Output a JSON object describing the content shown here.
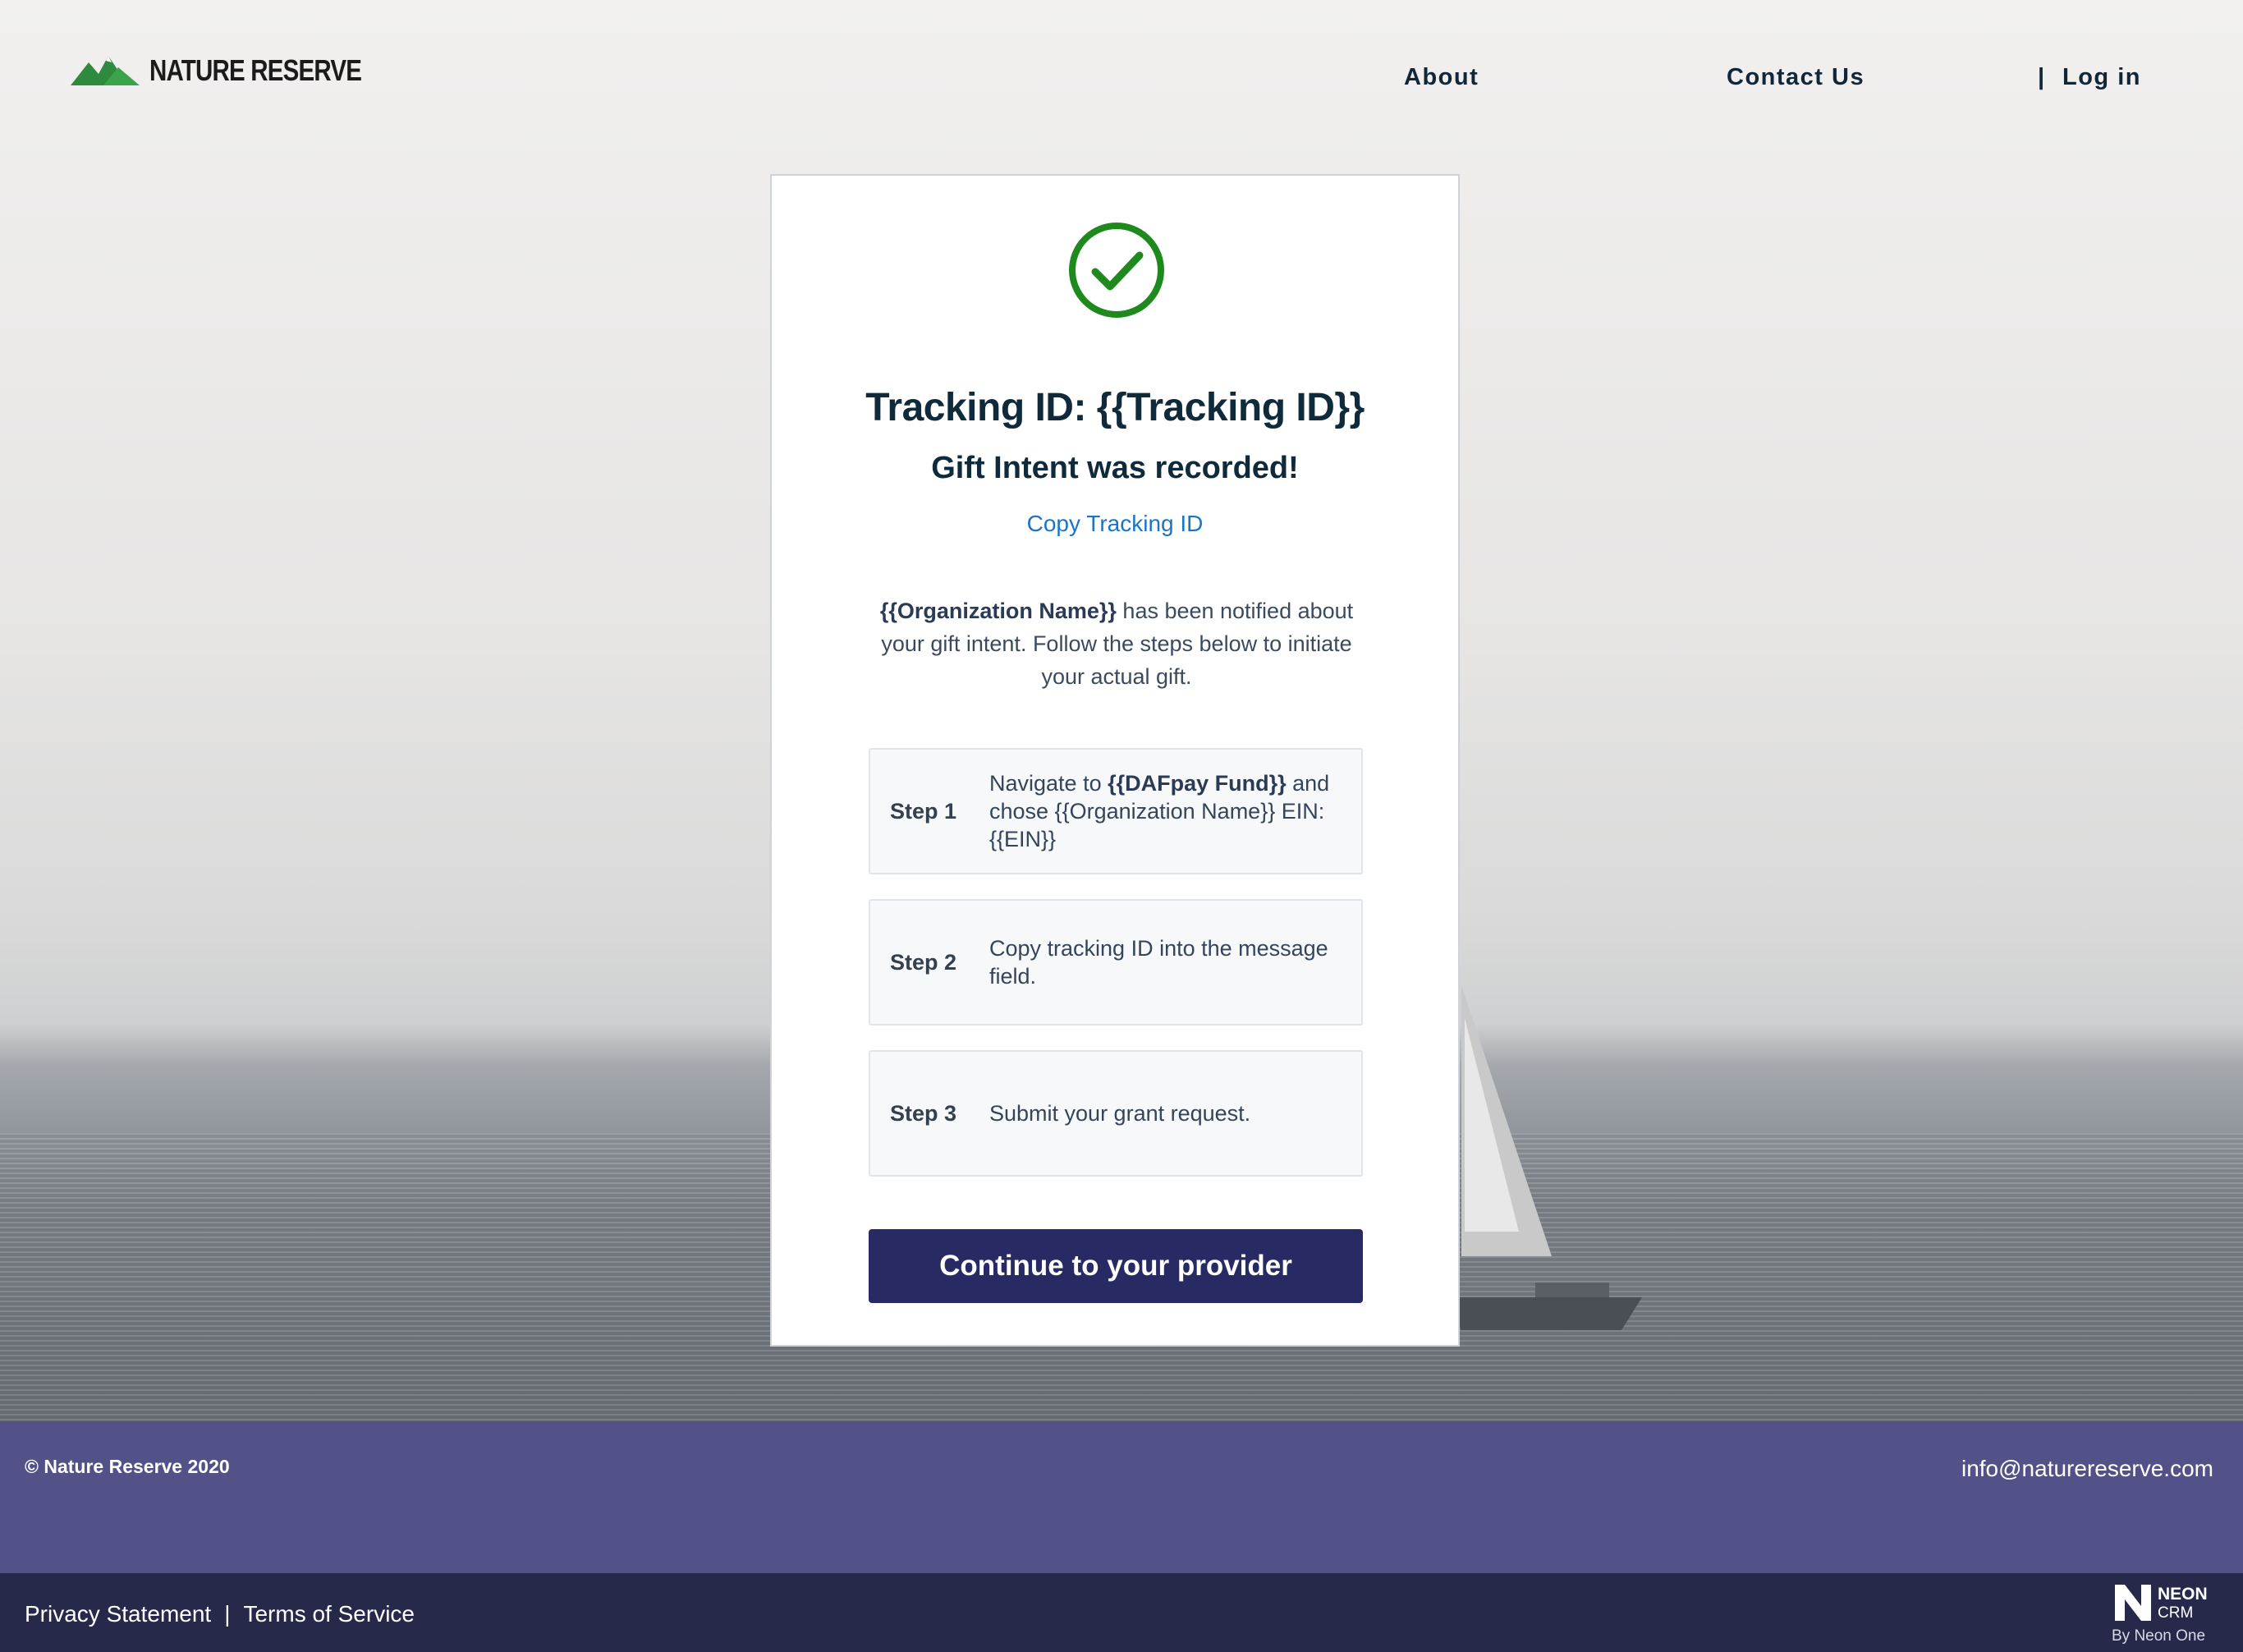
{
  "header": {
    "logo_text": "NATURE RESERVE",
    "nav": {
      "about": "About",
      "contact": "Contact Us",
      "separator": "|",
      "login": "Log in"
    }
  },
  "card": {
    "title": "Tracking ID: {{Tracking ID}}",
    "subtitle": "Gift Intent was recorded!",
    "copy_link": "Copy Tracking ID",
    "notice_org": "{{Organization Name}}",
    "notice_text": " has been notified about your gift intent. Follow the steps below to initiate your actual gift.",
    "steps": [
      {
        "label": "Step 1",
        "text_before": "Navigate to ",
        "text_bold": "{{DAFpay Fund}}",
        "text_after": " and chose {{Organization Name}} EIN: {{EIN}}"
      },
      {
        "label": "Step 2",
        "text": "Copy tracking ID into the message field."
      },
      {
        "label": "Step 3",
        "text": "Submit your grant request."
      }
    ],
    "cta_label": "Continue to your provider"
  },
  "footer": {
    "copyright": "© Nature Reserve 2020",
    "email": "info@naturereserve.com",
    "privacy": "Privacy Statement",
    "separator": "|",
    "terms": "Terms of Service",
    "neon_word": "NEON",
    "neon_crm": "CRM",
    "neon_by": "By Neon One"
  },
  "colors": {
    "brand_navy": "#272a63",
    "footer_purple": "#525288",
    "footer_dark": "#27294a",
    "success_green": "#1e8a1e",
    "link_blue": "#1a74c7",
    "logo_green": "#2e8b3e"
  },
  "icons": {
    "logo": "mountain-logo-icon",
    "success": "check-circle-icon",
    "neon": "neon-crm-logo-icon"
  }
}
